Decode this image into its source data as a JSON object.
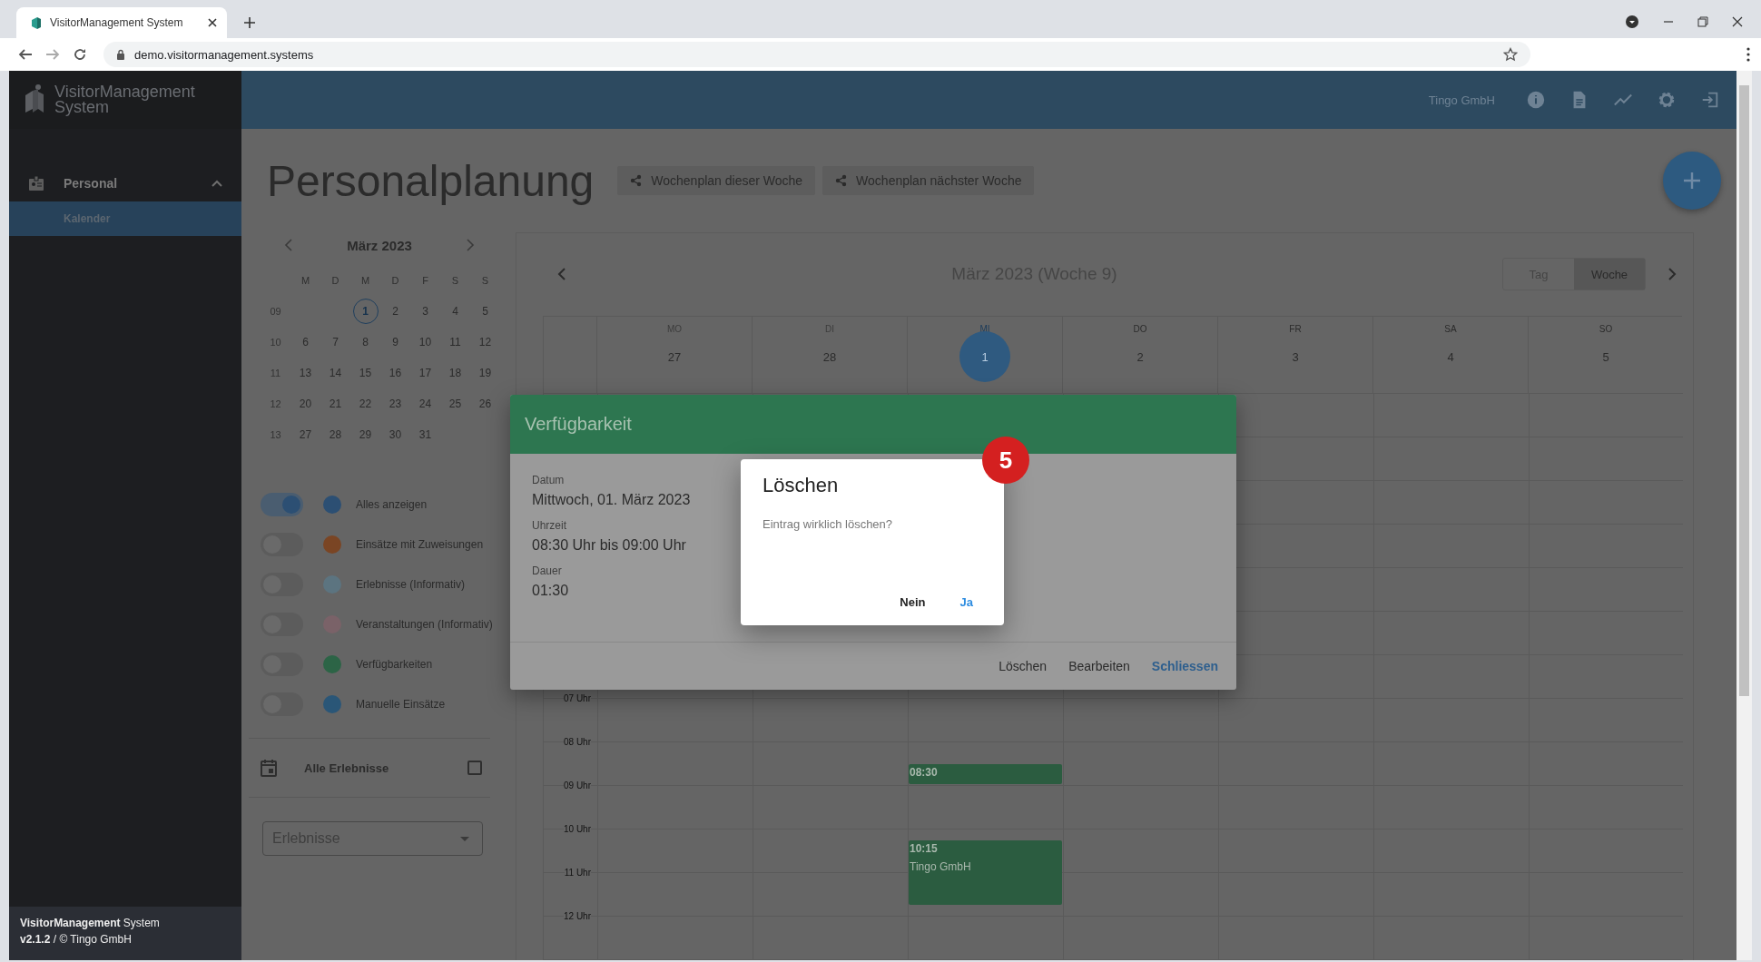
{
  "browser": {
    "tab_title": "VisitorManagement System",
    "url": "demo.visitormanagement.systems"
  },
  "sidebar": {
    "brand": [
      "VisitorManagement",
      "System"
    ],
    "nav": [
      {
        "label": "Personal",
        "expanded": true,
        "children": [
          {
            "label": "Kalender",
            "selected": true
          }
        ]
      }
    ],
    "footer": [
      "**VisitorManagement** System",
      "**v2.1.2** / © Tingo GmbH"
    ]
  },
  "topbar": {
    "company": "Tingo GmbH"
  },
  "page": {
    "title": "Personalplanung",
    "share_buttons": [
      "Wochenplan dieser Woche",
      "Wochenplan nächster Woche"
    ]
  },
  "mini_calendar": {
    "month": "März 2023",
    "weekdays": [
      "M",
      "D",
      "M",
      "D",
      "F",
      "S",
      "S"
    ],
    "weeks": [
      {
        "week": "09",
        "days": [
          {
            "label": "1",
            "selected": true
          },
          {
            "label": "2",
            "selected": false
          },
          {
            "label": "3",
            "selected": false
          },
          {
            "label": "4",
            "selected": false
          },
          {
            "label": "5",
            "selected": false
          }
        ]
      },
      {
        "week": "10",
        "days": [
          {
            "label": "6",
            "selected": false
          },
          {
            "label": "7",
            "selected": false
          },
          {
            "label": "8",
            "selected": false
          },
          {
            "label": "9",
            "selected": false
          },
          {
            "label": "10",
            "selected": false
          },
          {
            "label": "11",
            "selected": false
          },
          {
            "label": "12",
            "selected": false
          }
        ]
      },
      {
        "week": "11",
        "days": [
          {
            "label": "13",
            "selected": false
          },
          {
            "label": "14",
            "selected": false
          },
          {
            "label": "15",
            "selected": false
          },
          {
            "label": "16",
            "selected": false
          },
          {
            "label": "17",
            "selected": false
          },
          {
            "label": "18",
            "selected": false
          },
          {
            "label": "19",
            "selected": false
          }
        ]
      },
      {
        "week": "12",
        "days": [
          {
            "label": "20",
            "selected": false
          },
          {
            "label": "21",
            "selected": false
          },
          {
            "label": "22",
            "selected": false
          },
          {
            "label": "23",
            "selected": false
          },
          {
            "label": "24",
            "selected": false
          },
          {
            "label": "25",
            "selected": false
          },
          {
            "label": "26",
            "selected": false
          }
        ]
      },
      {
        "week": "13",
        "days": [
          {
            "label": "27",
            "selected": false
          },
          {
            "label": "28",
            "selected": false
          },
          {
            "label": "29",
            "selected": false
          },
          {
            "label": "30",
            "selected": false
          },
          {
            "label": "31",
            "selected": false
          }
        ]
      }
    ]
  },
  "filters": [
    {
      "label": "Alles anzeigen",
      "on": true,
      "color": "#2c4f73"
    },
    {
      "label": "Einsätze mit Zuweisungen",
      "on": false,
      "color": "#7a4524"
    },
    {
      "label": "Erlebnisse (Informativ)",
      "on": false,
      "color": "#5c7480"
    },
    {
      "label": "Veranstaltungen (Informativ)",
      "on": false,
      "color": "#7a6268"
    },
    {
      "label": "Verfügbarkeiten",
      "on": false,
      "color": "#2c6446"
    },
    {
      "label": "Manuelle Einsätze",
      "on": false,
      "color": "#2a5677"
    }
  ],
  "all_events": {
    "label": "Alle Erlebnisse",
    "checked": false
  },
  "event_select": {
    "placeholder": "Erlebnisse"
  },
  "calendar": {
    "title": "März 2023 (Woche 9)",
    "views": [
      {
        "label": "Tag",
        "selected": false
      },
      {
        "label": "Woche",
        "selected": true
      }
    ],
    "days": [
      {
        "name": "MO",
        "date": "27",
        "past": true,
        "selected": false
      },
      {
        "name": "DI",
        "date": "28",
        "past": true,
        "selected": false
      },
      {
        "name": "MI",
        "date": "1",
        "past": false,
        "selected": true
      },
      {
        "name": "DO",
        "date": "2",
        "past": false,
        "selected": false
      },
      {
        "name": "FR",
        "date": "3",
        "past": false,
        "selected": false
      },
      {
        "name": "SA",
        "date": "4",
        "past": false,
        "selected": false
      },
      {
        "name": "SO",
        "date": "5",
        "past": false,
        "selected": false
      }
    ],
    "hours": [
      "07 Uhr",
      "08 Uhr",
      "09 Uhr",
      "10 Uhr",
      "11 Uhr",
      "12 Uhr"
    ],
    "events": [
      {
        "time": "08:30"
      },
      {
        "time": "10:15",
        "title": "Tingo GmbH"
      }
    ]
  },
  "detail_dialog": {
    "title": "Verfügbarkeit",
    "fields": [
      {
        "label": "Datum",
        "value": "Mittwoch, 01. März 2023"
      },
      {
        "label": "Uhrzeit",
        "value": "08:30 Uhr bis 09:00 Uhr"
      },
      {
        "label": "Dauer",
        "value": "01:30"
      }
    ],
    "actions": [
      {
        "label": "Löschen",
        "primary": false
      },
      {
        "label": "Bearbeiten",
        "primary": false
      },
      {
        "label": "Schliessen",
        "primary": true
      }
    ]
  },
  "confirm_dialog": {
    "title": "Löschen",
    "message": "Eintrag wirklich löschen?",
    "actions": [
      {
        "label": "Nein",
        "primary": false
      },
      {
        "label": "Ja",
        "primary": true
      }
    ]
  },
  "step_badge": "5"
}
